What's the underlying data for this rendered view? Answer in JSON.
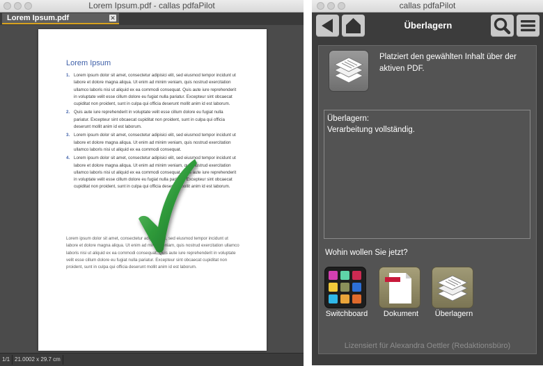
{
  "viewer": {
    "window_title": "Lorem Ipsum.pdf - callas pdfaPilot",
    "tab_label": "Lorem Ipsum.pdf",
    "tab_close": "✕",
    "doc": {
      "title": "Lorem Ipsum",
      "list": [
        {
          "num": "1.",
          "text": "Lorem ipsum dolor sit amet, consectetur adipisici elit, sed eiusmod tempor incidunt ut labore et dolore magna aliqua. Ut enim ad minim veniam, quis nostrud exercitation ullamco laboris nisi ut aliquid ex ea commodi consequat. Quis aute iure reprehenderit in voluptate velit esse cillum dolore eu fugiat nulla pariatur. Excepteur sint obcaecat cupiditat non proident, sunt in culpa qui officia deserunt mollit anim id est laborum."
        },
        {
          "num": "2.",
          "text": "Quis aute iure reprehenderit in voluptate velit esse cillum dolore eu fugiat nulla pariatur. Excepteur sint obcaecat cupiditat non proident, sunt in culpa qui officia deserunt mollit anim id est laborum."
        },
        {
          "num": "3.",
          "text": "Lorem ipsum dolor sit amet, consectetur adipisici elit, sed eiusmod tempor incidunt ut labore et dolore magna aliqua. Ut enim ad minim veniam, quis nostrud exercitation ullamco laboris nisi ut aliquid ex ea commodi consequat."
        },
        {
          "num": "4.",
          "text": "Lorem ipsum dolor sit amet, consectetur adipisici elit, sed eiusmod tempor incidunt ut labore et dolore magna aliqua. Ut enim ad minim veniam, quis nostrud exercitation ullamco laboris nisi ut aliquid ex ea commodi consequat. Quis aute iure reprehenderit in voluptate velit esse cillum dolore eu fugiat nulla pariatur. Excepteur sint obcaecat cupiditat non proident, sunt in culpa qui officia deserunt mollit anim id est laborum."
        }
      ],
      "paragraph": "Lorem ipsum dolor sit amet, consectetur adipisici elit, sed eiusmod tempor incidunt ut labore et dolore magna aliqua. Ut enim ad minim veniam, quis nostrud exercitation ullamco laboris nisi ut aliquid ex ea commodi consequat. Quis aute iure reprehenderit in voluptate velit esse cillum dolore eu fugiat nulla pariatur. Excepteur sint obcaecat cupiditat non proident, sunt in culpa qui officia deserunt mollit anim id est laborum."
    },
    "status": {
      "page": "1/1",
      "size": "21.0002 x 29.7 cm"
    }
  },
  "panel": {
    "window_title": "callas pdfaPilot",
    "header_title": "Überlagern",
    "description": "Platziert den gewählten Inhalt über der aktiven PDF.",
    "log": [
      "Überlagern:",
      "Verarbeitung vollständig."
    ],
    "where_prompt": "Wohin wollen Sie jetzt?",
    "nav": [
      {
        "label": "Switchboard",
        "icon": "switchboard-icon"
      },
      {
        "label": "Dokument",
        "icon": "document-icon"
      },
      {
        "label": "Überlagern",
        "icon": "overlay-icon"
      }
    ],
    "license": "Lizensiert für Alexandra Oettler (Redaktionsbüro)"
  },
  "colors": {
    "accent_tab": "#d8a21e",
    "doc_heading": "#3d5fa8",
    "arrow": "#2e8b3a"
  }
}
